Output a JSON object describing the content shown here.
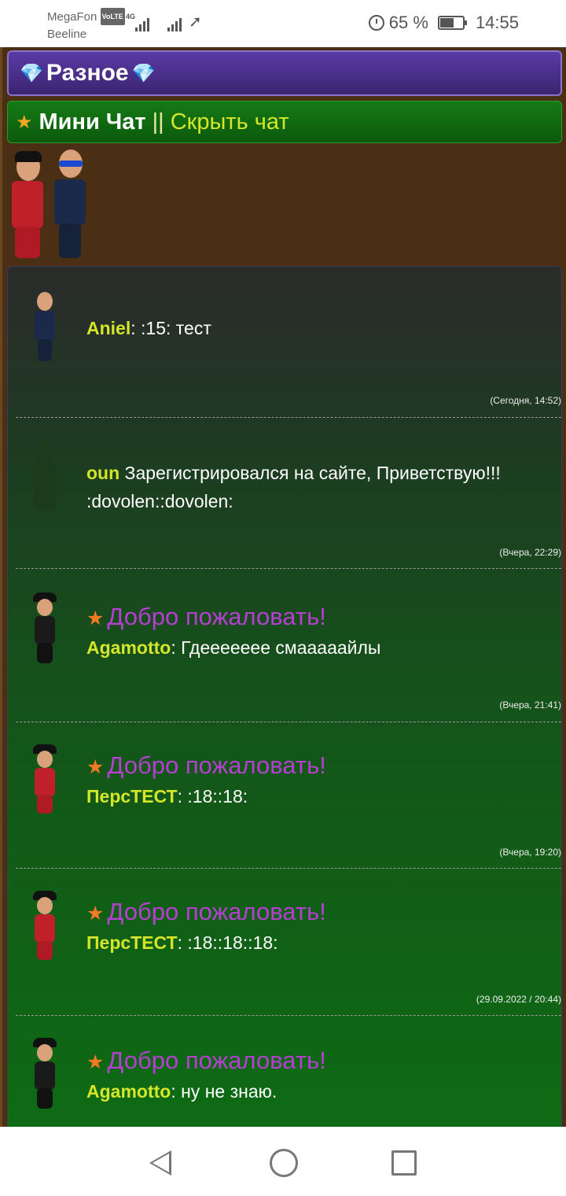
{
  "status": {
    "carrier1": "MegaFon",
    "volte": "VoLTE",
    "carrier2": "Beeline",
    "network": "4G",
    "battery_text": "65 %",
    "battery_level": 0.65,
    "time": "14:55"
  },
  "header": {
    "section_title": "Разное",
    "chat_title": "Мини Чат",
    "separator": "||",
    "hide_link": "Скрыть чат"
  },
  "messages": [
    {
      "welcome": "",
      "nick": "Aniel",
      "sep": ":",
      "text": " :15: тест",
      "time": "(Сегодня, 14:52)"
    },
    {
      "welcome": "",
      "nick": "oun",
      "sep": "",
      "text": " Зарегистрировался на сайте, Приветствую!!! :dovolen::dovolen:",
      "time": "(Вчера, 22:29)"
    },
    {
      "welcome": "Добро пожаловать!",
      "nick": "Agamotto",
      "sep": ":",
      "text": " Гдееееееe смааааайлы",
      "time": "(Вчера, 21:41)"
    },
    {
      "welcome": "Добро пожаловать!",
      "nick": "ПерсТЕСТ",
      "sep": ":",
      "text": " :18::18:",
      "time": "(Вчера, 19:20)"
    },
    {
      "welcome": "Добро пожаловать!",
      "nick": "ПерсТЕСТ",
      "sep": ":",
      "text": " :18::18::18:",
      "time": "(29.09.2022 / 20:44)"
    },
    {
      "welcome": "Добро пожаловать!",
      "nick": "Agamotto",
      "sep": ":",
      "text": " ну не знаю.",
      "time": ""
    }
  ],
  "colors": {
    "accent_nick": "#d4e62a",
    "welcome": "#b53fd0",
    "header_purple": "#5a3aa5",
    "header_green": "#147a14"
  }
}
